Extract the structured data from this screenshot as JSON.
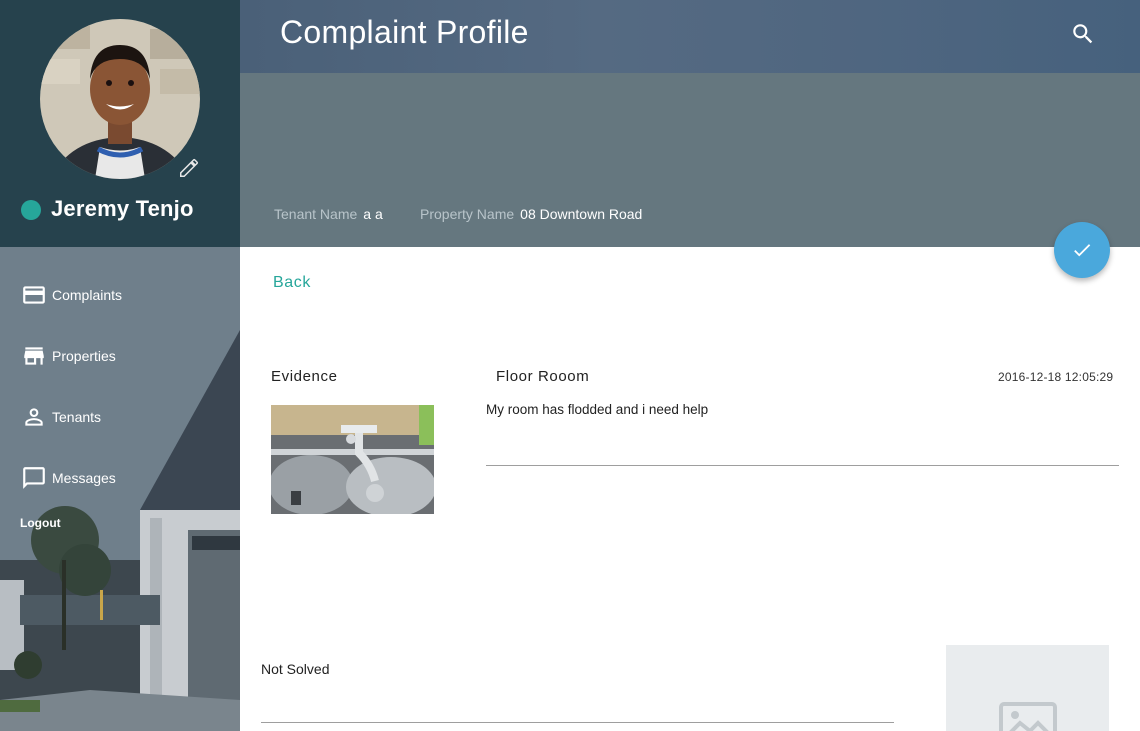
{
  "sidebar": {
    "user_name": "Jeremy Tenjo",
    "status_color": "#26a69a",
    "nav": [
      {
        "label": "Complaints",
        "icon": "credit-card-icon"
      },
      {
        "label": "Properties",
        "icon": "store-icon"
      },
      {
        "label": "Tenants",
        "icon": "person-icon"
      },
      {
        "label": "Messages",
        "icon": "chat-bubble-icon"
      }
    ],
    "logout_label": "Logout"
  },
  "header": {
    "title": "Complaint Profile",
    "tenant_name_label": "Tenant Name",
    "tenant_name_value": "a a",
    "property_name_label": "Property Name",
    "property_name_value": "08 Downtown Road"
  },
  "content": {
    "back_label": "Back",
    "evidence_title": "Evidence",
    "complaint_title": "Floor Rooom",
    "complaint_date": "2016-12-18 12:05:29",
    "complaint_body": "My room has flodded and i need help",
    "status": "Not Solved"
  },
  "colors": {
    "accent": "#26a69a",
    "fab": "#4aa8dc",
    "profile_panel": "#26424d"
  }
}
